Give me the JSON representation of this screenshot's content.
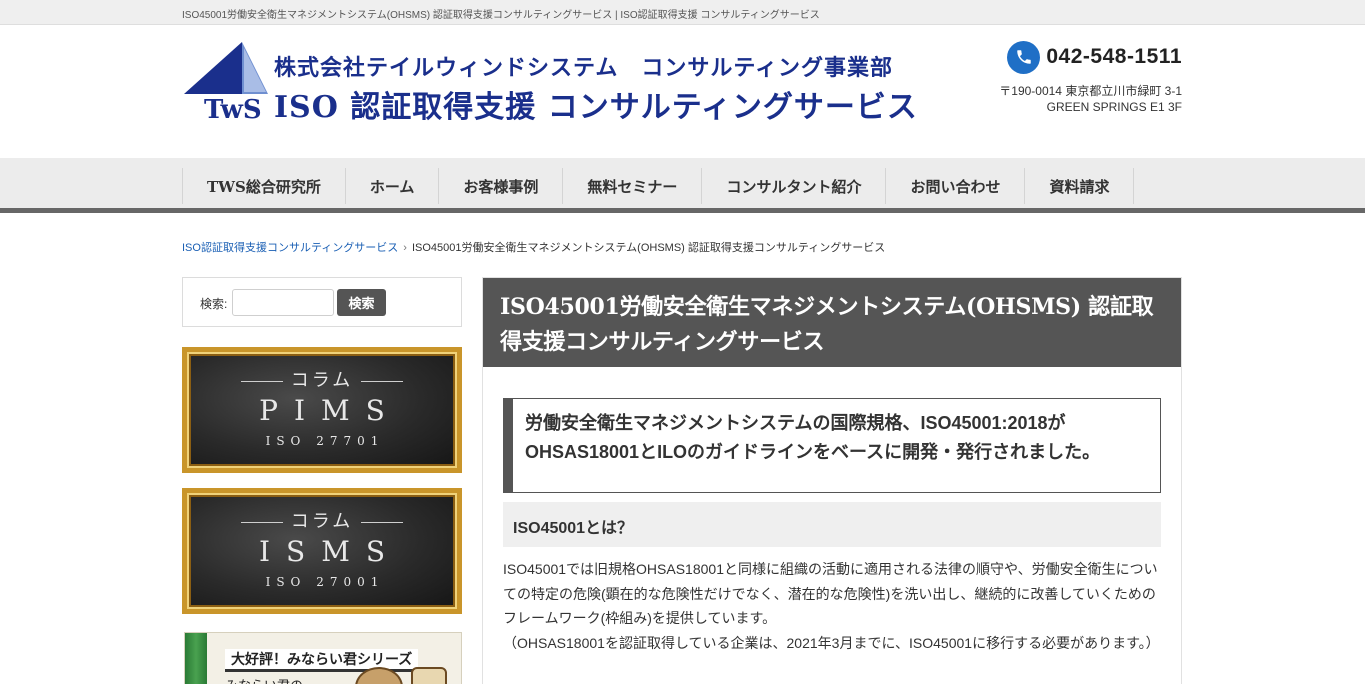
{
  "topbar": {
    "text": "ISO45001労働安全衛生マネジメントシステム(OHSMS) 認証取得支援コンサルティングサービス | ISO認証取得支援 コンサルティングサービス"
  },
  "header": {
    "logo": {
      "mark_text": "TwS",
      "line1": "株式会社テイルウィンドシステム　コンサルティング事業部",
      "line2": "ISO 認証取得支援 コンサルティングサービス"
    },
    "contact": {
      "phone": "042-548-1511",
      "address_line1": "〒190-0014 東京都立川市緑町 3-1",
      "address_line2": "GREEN SPRINGS E1 3F"
    }
  },
  "nav": {
    "items": [
      {
        "label": "TWS総合研究所"
      },
      {
        "label": "ホーム"
      },
      {
        "label": "お客様事例"
      },
      {
        "label": "無料セミナー"
      },
      {
        "label": "コンサルタント紹介"
      },
      {
        "label": "お問い合わせ"
      },
      {
        "label": "資料請求"
      }
    ]
  },
  "breadcrumb": {
    "home": "ISO認証取得支援コンサルティングサービス",
    "separator": "›",
    "current": "ISO45001労働安全衛生マネジメントシステム(OHSMS) 認証取得支援コンサルティングサービス"
  },
  "sidebar": {
    "search": {
      "label": "検索:",
      "placeholder": "",
      "button": "検索"
    },
    "banners": [
      {
        "top": "コラム",
        "main": "PIMS",
        "sub": "ISO 27701"
      },
      {
        "top": "コラム",
        "main": "ISMS",
        "sub": "ISO 27001"
      }
    ],
    "banner3": {
      "title": "大好評！みならい君シリーズ",
      "subtitle": "みならい君の"
    }
  },
  "main": {
    "title": "ISO45001労働安全衛生マネジメントシステム(OHSMS) 認証取得支援コンサルティングサービス",
    "lead": "労働安全衛生マネジメントシステムの国際規格、ISO45001:2018がOHSAS18001とILOのガイドラインをベースに開発・発行されました。",
    "section_heading": "ISO45001とは？",
    "paragraph1": "ISO45001では旧規格OHSAS18001と同様に組織の活動に適用される法律の順守や、労働安全衛生についての特定の危険(顕在的な危険性だけでなく、潜在的な危険性)を洗い出し、継続的に改善していくためのフレームワーク(枠組み)を提供しています。",
    "paragraph2": "（OHSAS18001を認証取得している企業は、2021年3月までに、ISO45001に移行する必要があります。）"
  },
  "colors": {
    "brand_blue": "#1a2f8c",
    "phone_icon_blue": "#1f6fc6",
    "title_bar": "#555555",
    "link": "#1a5fb4",
    "frame_gold": "#c9952a"
  }
}
